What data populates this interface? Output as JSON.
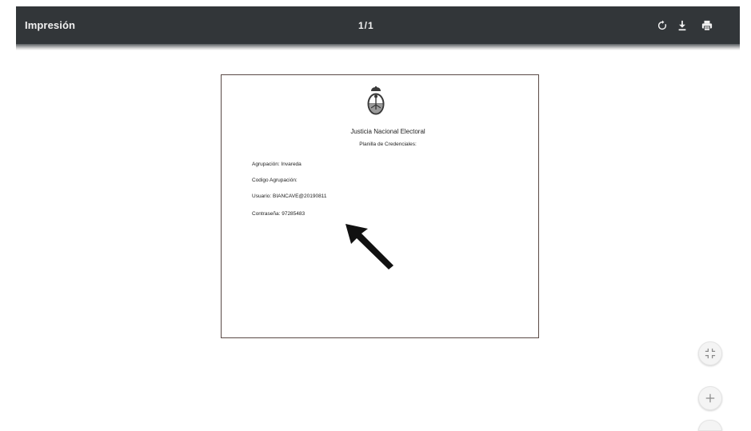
{
  "toolbar": {
    "title": "Impresión",
    "page_indicator": "1/1",
    "icons": [
      "rotate-icon",
      "download-icon",
      "print-icon"
    ],
    "background": "#323639"
  },
  "document": {
    "heading": "Justicia Nacional Electoral",
    "subheading": "Planilla de Credenciales:",
    "lines": [
      "Agrupación: Invareda",
      "Codigo Agrupación:",
      "Usuario: BIANCAVE@20190811",
      "Contraseña: 97285483"
    ]
  },
  "floating_controls": [
    "fit-page-icon",
    "zoom-in-icon"
  ]
}
